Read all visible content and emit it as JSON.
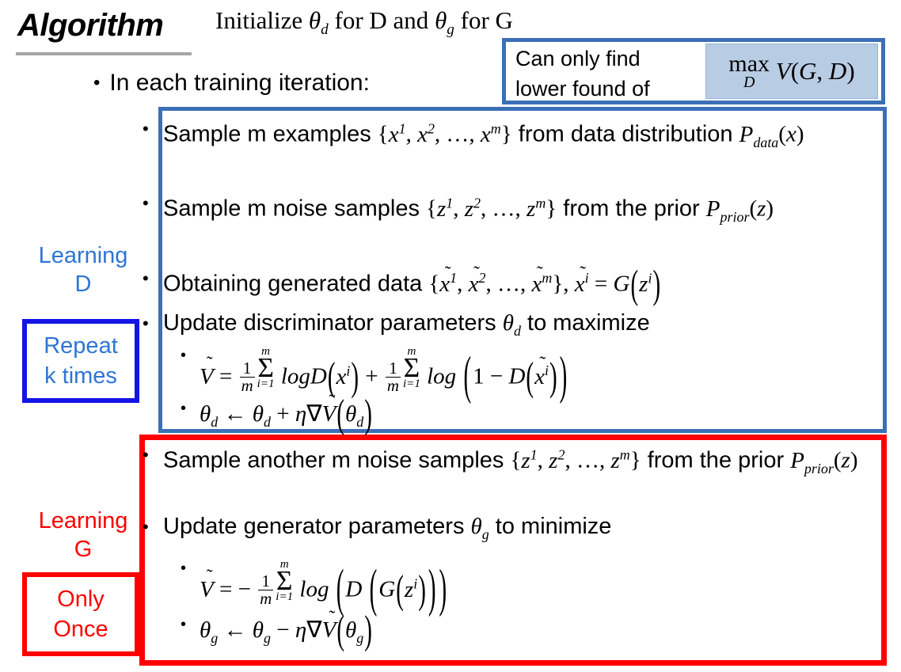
{
  "slide": {
    "title": "Algorithm",
    "init_line": "Initialize θd for D and θg for G",
    "iteration_line": "In each training iteration:"
  },
  "callout": {
    "text_line1": "Can only find",
    "text_line2": "lower found of",
    "formula": "max_D V(G, D)",
    "border_color": "#3b6fb6",
    "formula_bg_color": "#b8cce4"
  },
  "side_labels": {
    "learning_d": "Learning D",
    "learning_d_line1": "Learning",
    "learning_d_line2": "D",
    "learning_g_line1": "Learning",
    "learning_g_line2": "G",
    "repeat_line1": "Repeat",
    "repeat_line2": "k times",
    "only_line1": "Only",
    "only_line2": "Once",
    "blue_color": "#2e75d4",
    "blue_box_color": "#1414e6",
    "red_color": "#ff0000"
  },
  "learning_d_steps": [
    {
      "id": "sample-examples",
      "text": "Sample m examples {x¹, x², …, xᵐ} from data distribution Pdata(x)"
    },
    {
      "id": "sample-noise",
      "text": "Sample m noise samples {z¹, z², …, zᵐ} from the prior Pprior(z)"
    },
    {
      "id": "obtain-generated",
      "text": "Obtaining generated data {x̃¹, x̃², …, x̃ᵐ}, x̃ⁱ = G(zⁱ)"
    },
    {
      "id": "update-discriminator",
      "text": "Update discriminator parameters θd to maximize"
    }
  ],
  "learning_d_formulas": [
    {
      "id": "v-tilde-discriminator",
      "text": "Ṽ = 1/m Σᵢ₌₁ᵐ logD(xⁱ) + 1/m Σᵢ₌₁ᵐ log(1 − D(x̃ⁱ))"
    },
    {
      "id": "theta-d-update",
      "text": "θd ← θd + η∇Ṽ(θd)"
    }
  ],
  "learning_g_steps": [
    {
      "id": "sample-another-noise",
      "text": "Sample another m noise samples {z¹, z², …, zᵐ} from the prior Pprior(z)"
    },
    {
      "id": "update-generator",
      "text": "Update generator parameters θg to minimize"
    }
  ],
  "learning_g_formulas": [
    {
      "id": "v-tilde-generator",
      "text": "Ṽ = − 1/m Σᵢ₌₁ᵐ log(D(G(zⁱ)))"
    },
    {
      "id": "theta-g-update",
      "text": "θg ← θg − η∇Ṽ(θg)"
    }
  ],
  "boxes": {
    "blue_border_color": "#3b6fb6",
    "red_border_color": "#ff0000"
  },
  "bullets": {
    "glyph": "•"
  }
}
